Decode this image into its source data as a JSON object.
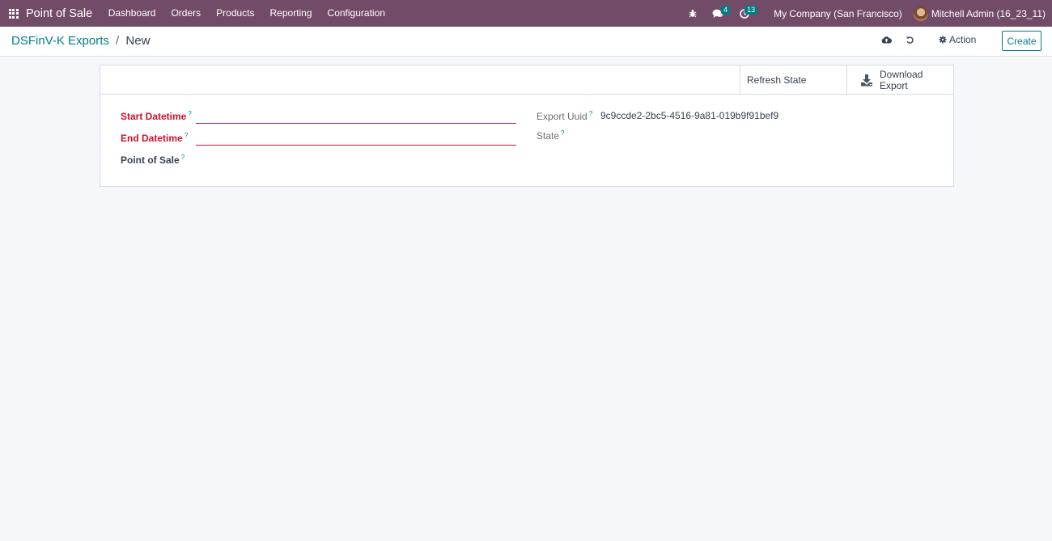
{
  "navbar": {
    "brand": "Point of Sale",
    "menu": [
      "Dashboard",
      "Orders",
      "Products",
      "Reporting",
      "Configuration"
    ],
    "messages_badge": "4",
    "activities_badge": "13",
    "company": "My Company (San Francisco)",
    "user": "Mitchell Admin (16_23_11)"
  },
  "control_panel": {
    "breadcrumb_parent": "DSFinV-K Exports",
    "breadcrumb_separator": "/",
    "breadcrumb_current": "New",
    "action_label": "Action",
    "create_label": "Create"
  },
  "button_box": {
    "refresh_label": "Refresh State",
    "download_label_line1": "Download",
    "download_label_line2": "Export"
  },
  "form": {
    "start_datetime": {
      "label": "Start Datetime",
      "help": "?",
      "value": ""
    },
    "end_datetime": {
      "label": "End Datetime",
      "help": "?",
      "value": ""
    },
    "point_of_sale": {
      "label": "Point of Sale",
      "help": "?",
      "value": ""
    },
    "export_uuid": {
      "label": "Export Uuid",
      "help": "?",
      "value": "9c9ccde2-2bc5-4516-9a81-019b9f91bef9"
    },
    "state": {
      "label": "State",
      "help": "?",
      "value": ""
    }
  },
  "colors": {
    "navbar": "#714b67",
    "accent": "#017e84",
    "required": "#d01030",
    "background": "#f6f7fa"
  },
  "icons": [
    "apps-grid-icon",
    "bug-icon",
    "chat-icon",
    "clock-icon",
    "cloud-upload-icon",
    "undo-icon",
    "gear-icon",
    "download-icon"
  ]
}
